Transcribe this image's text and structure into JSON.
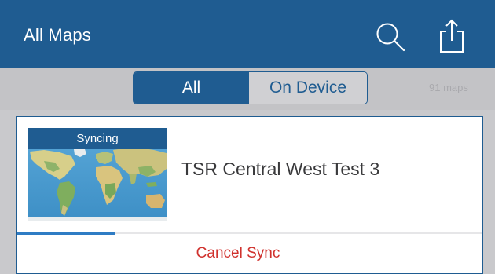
{
  "header": {
    "title": "All Maps",
    "icons": [
      "search-icon",
      "share-icon"
    ]
  },
  "filter": {
    "segments": [
      {
        "label": "All",
        "selected": true
      },
      {
        "label": "On Device",
        "selected": false
      }
    ],
    "count_text": "91 maps"
  },
  "map_card": {
    "status": "Syncing",
    "title": "TSR Central West Test 3",
    "sync_progress": 0.21,
    "cancel_label": "Cancel Sync"
  },
  "colors": {
    "nav_blue": "#1f5c91",
    "cancel_red": "#d0312d",
    "progress_blue": "#2f7cc4",
    "background_gray": "#c9c9cc"
  }
}
